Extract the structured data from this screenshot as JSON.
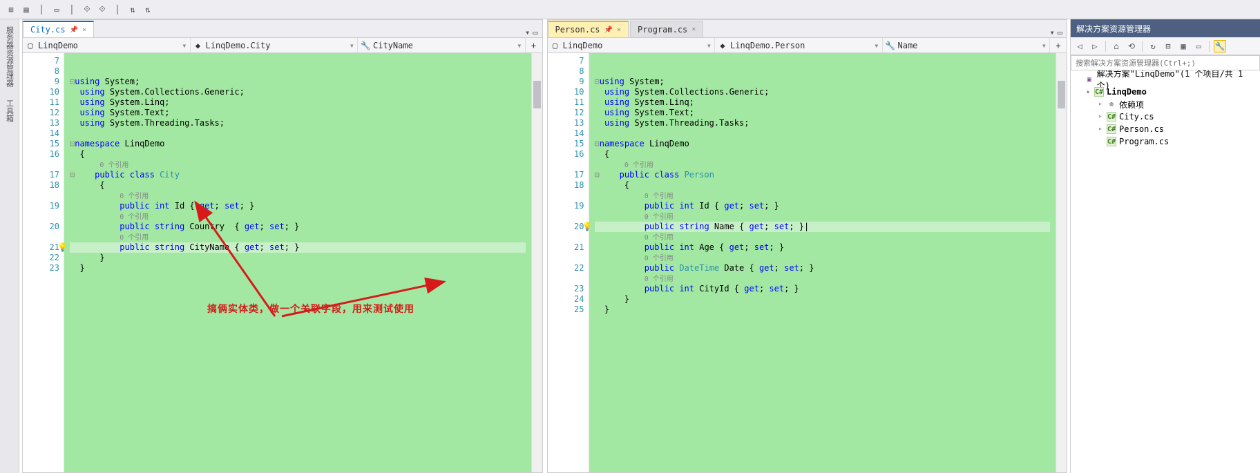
{
  "toolbar_icons": [
    "tool1",
    "tool2",
    "tool3",
    "sep",
    "tool4",
    "tool5",
    "tool6",
    "sep",
    "tool7",
    "tool8"
  ],
  "left_sidebar": [
    "服务器资源管理器",
    "工具箱"
  ],
  "editors": [
    {
      "tabs": [
        {
          "label": "City.cs",
          "active": true,
          "pin": true
        }
      ],
      "nav": {
        "ns": "LinqDemo",
        "cls": "LinqDemo.City",
        "mem": "CityName"
      },
      "lines": [
        {
          "n": "7",
          "t": "",
          "kind": "comment"
        },
        {
          "n": "8",
          "t": ""
        },
        {
          "n": "9",
          "html": "<span class='kw'>using</span> <span class='txt'>System;</span>",
          "fold": true
        },
        {
          "n": "10",
          "html": "<span class='kw'>using</span> <span class='txt'>System.Collections.Generic;</span>"
        },
        {
          "n": "11",
          "html": "<span class='kw'>using</span> <span class='txt'>System.Linq;</span>"
        },
        {
          "n": "12",
          "html": "<span class='kw'>using</span> <span class='txt'>System.Text;</span>"
        },
        {
          "n": "13",
          "html": "<span class='kw'>using</span> <span class='txt'>System.Threading.Tasks;</span>"
        },
        {
          "n": "14",
          "t": ""
        },
        {
          "n": "15",
          "html": "<span class='kw'>namespace</span> <span class='txt'>LinqDemo</span>",
          "fold": true
        },
        {
          "n": "16",
          "html": "<span class='txt'>{</span>"
        },
        {
          "n": "",
          "html": "    <span class='ref'>0 个引用</span>"
        },
        {
          "n": "17",
          "html": "    <span class='kw'>public class</span> <span class='cls'>City</span>",
          "fold": true
        },
        {
          "n": "18",
          "html": "    <span class='txt'>{</span>"
        },
        {
          "n": "",
          "html": "        <span class='ref'>0 个引用</span>"
        },
        {
          "n": "19",
          "html": "        <span class='kw'>public int</span> <span class='txt'>Id { </span><span class='kw'>get</span><span class='txt'>; </span><span class='kw'>set</span><span class='txt'>; }</span>"
        },
        {
          "n": "",
          "html": "        <span class='ref'>0 个引用</span>"
        },
        {
          "n": "20",
          "html": "        <span class='kw'>public string</span> <span class='txt'>Country  { </span><span class='kw'>get</span><span class='txt'>; </span><span class='kw'>set</span><span class='txt'>; }</span>"
        },
        {
          "n": "",
          "html": "        <span class='ref'>0 个引用</span>"
        },
        {
          "n": "21",
          "html": "        <span class='kw'>public string</span> <span class='txt'>CityName { </span><span class='kw'>get</span><span class='txt'>; </span><span class='kw'>set</span><span class='txt'>; }</span>",
          "bulb": true,
          "hl": true
        },
        {
          "n": "22",
          "html": "    <span class='txt'>}</span>"
        },
        {
          "n": "23",
          "html": "<span class='txt'>}</span>"
        }
      ]
    },
    {
      "tabs": [
        {
          "label": "Person.cs",
          "active": true,
          "yellow": true,
          "pin": true
        },
        {
          "label": "Program.cs",
          "active": false
        }
      ],
      "nav": {
        "ns": "LinqDemo",
        "cls": "LinqDemo.Person",
        "mem": "Name"
      },
      "lines": [
        {
          "n": "7",
          "t": "",
          "kind": "comment"
        },
        {
          "n": "8",
          "t": ""
        },
        {
          "n": "9",
          "html": "<span class='kw'>using</span> <span class='txt'>System;</span>",
          "fold": true
        },
        {
          "n": "10",
          "html": "<span class='kw'>using</span> <span class='txt'>System.Collections.Generic;</span>"
        },
        {
          "n": "11",
          "html": "<span class='kw'>using</span> <span class='txt'>System.Linq;</span>"
        },
        {
          "n": "12",
          "html": "<span class='kw'>using</span> <span class='txt'>System.Text;</span>"
        },
        {
          "n": "13",
          "html": "<span class='kw'>using</span> <span class='txt'>System.Threading.Tasks;</span>"
        },
        {
          "n": "14",
          "t": ""
        },
        {
          "n": "15",
          "html": "<span class='kw'>namespace</span> <span class='txt'>LinqDemo</span>",
          "fold": true
        },
        {
          "n": "16",
          "html": "<span class='txt'>{</span>"
        },
        {
          "n": "",
          "html": "    <span class='ref'>0 个引用</span>"
        },
        {
          "n": "17",
          "html": "    <span class='kw'>public class</span> <span class='cls'>Person</span>",
          "fold": true
        },
        {
          "n": "18",
          "html": "    <span class='txt'>{</span>"
        },
        {
          "n": "",
          "html": "        <span class='ref'>0 个引用</span>"
        },
        {
          "n": "19",
          "html": "        <span class='kw'>public int</span> <span class='txt'>Id { </span><span class='kw'>get</span><span class='txt'>; </span><span class='kw'>set</span><span class='txt'>; }</span>"
        },
        {
          "n": "",
          "html": "        <span class='ref'>0 个引用</span>"
        },
        {
          "n": "20",
          "html": "        <span class='kw'>public string</span> <span class='txt'>Name { </span><span class='kw'>get</span><span class='txt'>; </span><span class='kw'>set</span><span class='txt'>; }</span>|",
          "bulb": true,
          "hl": true
        },
        {
          "n": "",
          "html": "        <span class='ref'>0 个引用</span>"
        },
        {
          "n": "21",
          "html": "        <span class='kw'>public int</span> <span class='txt'>Age { </span><span class='kw'>get</span><span class='txt'>; </span><span class='kw'>set</span><span class='txt'>; }</span>"
        },
        {
          "n": "",
          "html": "        <span class='ref'>0 个引用</span>"
        },
        {
          "n": "22",
          "html": "        <span class='kw'>public</span> <span class='cls'>DateTime</span> <span class='txt'>Date { </span><span class='kw'>get</span><span class='txt'>; </span><span class='kw'>set</span><span class='txt'>; }</span>"
        },
        {
          "n": "",
          "html": "        <span class='ref'>0 个引用</span>"
        },
        {
          "n": "23",
          "html": "        <span class='kw'>public int</span> <span class='txt'>CityId { </span><span class='kw'>get</span><span class='txt'>; </span><span class='kw'>set</span><span class='txt'>; }</span>"
        },
        {
          "n": "24",
          "html": "    <span class='txt'>}</span>"
        },
        {
          "n": "25",
          "html": "<span class='txt'>}</span>"
        }
      ]
    }
  ],
  "right_pane": {
    "title": "解决方案资源管理器",
    "search_ph": "搜索解决方案资源管理器(Ctrl+;)",
    "toolbar_icons": [
      "back",
      "fwd",
      "home",
      "sync",
      "sep",
      "refresh",
      "collapse",
      "showall",
      "props",
      "sep",
      "wrench",
      "props2"
    ],
    "tree": [
      {
        "depth": 0,
        "exp": "",
        "ico": "sln",
        "label": "解决方案\"LinqDemo\"(1 个项目/共 1 个)"
      },
      {
        "depth": 1,
        "exp": "▴",
        "ico": "proj",
        "label": "LinqDemo",
        "bold": true
      },
      {
        "depth": 2,
        "exp": "▹",
        "ico": "dep",
        "label": "依赖项"
      },
      {
        "depth": 2,
        "exp": "▹",
        "ico": "cs",
        "label": "City.cs"
      },
      {
        "depth": 2,
        "exp": "▹",
        "ico": "cs",
        "label": "Person.cs"
      },
      {
        "depth": 2,
        "exp": "",
        "ico": "cs",
        "label": "Program.cs"
      }
    ]
  },
  "annotation": "搞俩实体类，做一个关联字段，用来测试使用"
}
